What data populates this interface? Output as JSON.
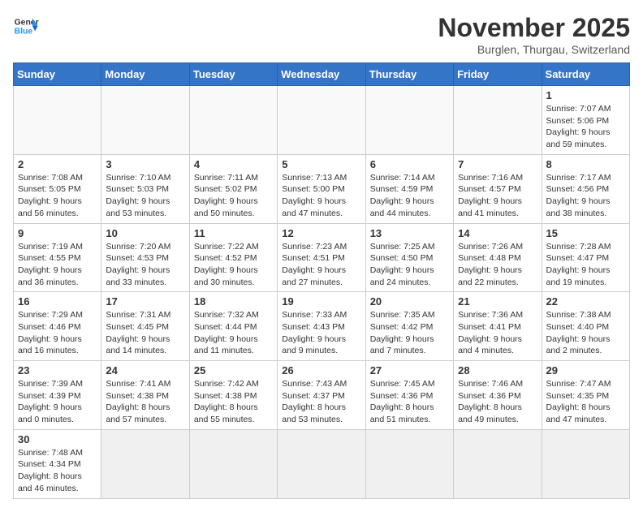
{
  "logo": {
    "text_general": "General",
    "text_blue": "Blue"
  },
  "title": "November 2025",
  "location": "Burglen, Thurgau, Switzerland",
  "weekdays": [
    "Sunday",
    "Monday",
    "Tuesday",
    "Wednesday",
    "Thursday",
    "Friday",
    "Saturday"
  ],
  "weeks": [
    [
      {
        "day": "",
        "info": ""
      },
      {
        "day": "",
        "info": ""
      },
      {
        "day": "",
        "info": ""
      },
      {
        "day": "",
        "info": ""
      },
      {
        "day": "",
        "info": ""
      },
      {
        "day": "",
        "info": ""
      },
      {
        "day": "1",
        "info": "Sunrise: 7:07 AM\nSunset: 5:06 PM\nDaylight: 9 hours and 59 minutes."
      }
    ],
    [
      {
        "day": "2",
        "info": "Sunrise: 7:08 AM\nSunset: 5:05 PM\nDaylight: 9 hours and 56 minutes."
      },
      {
        "day": "3",
        "info": "Sunrise: 7:10 AM\nSunset: 5:03 PM\nDaylight: 9 hours and 53 minutes."
      },
      {
        "day": "4",
        "info": "Sunrise: 7:11 AM\nSunset: 5:02 PM\nDaylight: 9 hours and 50 minutes."
      },
      {
        "day": "5",
        "info": "Sunrise: 7:13 AM\nSunset: 5:00 PM\nDaylight: 9 hours and 47 minutes."
      },
      {
        "day": "6",
        "info": "Sunrise: 7:14 AM\nSunset: 4:59 PM\nDaylight: 9 hours and 44 minutes."
      },
      {
        "day": "7",
        "info": "Sunrise: 7:16 AM\nSunset: 4:57 PM\nDaylight: 9 hours and 41 minutes."
      },
      {
        "day": "8",
        "info": "Sunrise: 7:17 AM\nSunset: 4:56 PM\nDaylight: 9 hours and 38 minutes."
      }
    ],
    [
      {
        "day": "9",
        "info": "Sunrise: 7:19 AM\nSunset: 4:55 PM\nDaylight: 9 hours and 36 minutes."
      },
      {
        "day": "10",
        "info": "Sunrise: 7:20 AM\nSunset: 4:53 PM\nDaylight: 9 hours and 33 minutes."
      },
      {
        "day": "11",
        "info": "Sunrise: 7:22 AM\nSunset: 4:52 PM\nDaylight: 9 hours and 30 minutes."
      },
      {
        "day": "12",
        "info": "Sunrise: 7:23 AM\nSunset: 4:51 PM\nDaylight: 9 hours and 27 minutes."
      },
      {
        "day": "13",
        "info": "Sunrise: 7:25 AM\nSunset: 4:50 PM\nDaylight: 9 hours and 24 minutes."
      },
      {
        "day": "14",
        "info": "Sunrise: 7:26 AM\nSunset: 4:48 PM\nDaylight: 9 hours and 22 minutes."
      },
      {
        "day": "15",
        "info": "Sunrise: 7:28 AM\nSunset: 4:47 PM\nDaylight: 9 hours and 19 minutes."
      }
    ],
    [
      {
        "day": "16",
        "info": "Sunrise: 7:29 AM\nSunset: 4:46 PM\nDaylight: 9 hours and 16 minutes."
      },
      {
        "day": "17",
        "info": "Sunrise: 7:31 AM\nSunset: 4:45 PM\nDaylight: 9 hours and 14 minutes."
      },
      {
        "day": "18",
        "info": "Sunrise: 7:32 AM\nSunset: 4:44 PM\nDaylight: 9 hours and 11 minutes."
      },
      {
        "day": "19",
        "info": "Sunrise: 7:33 AM\nSunset: 4:43 PM\nDaylight: 9 hours and 9 minutes."
      },
      {
        "day": "20",
        "info": "Sunrise: 7:35 AM\nSunset: 4:42 PM\nDaylight: 9 hours and 7 minutes."
      },
      {
        "day": "21",
        "info": "Sunrise: 7:36 AM\nSunset: 4:41 PM\nDaylight: 9 hours and 4 minutes."
      },
      {
        "day": "22",
        "info": "Sunrise: 7:38 AM\nSunset: 4:40 PM\nDaylight: 9 hours and 2 minutes."
      }
    ],
    [
      {
        "day": "23",
        "info": "Sunrise: 7:39 AM\nSunset: 4:39 PM\nDaylight: 9 hours and 0 minutes."
      },
      {
        "day": "24",
        "info": "Sunrise: 7:41 AM\nSunset: 4:38 PM\nDaylight: 8 hours and 57 minutes."
      },
      {
        "day": "25",
        "info": "Sunrise: 7:42 AM\nSunset: 4:38 PM\nDaylight: 8 hours and 55 minutes."
      },
      {
        "day": "26",
        "info": "Sunrise: 7:43 AM\nSunset: 4:37 PM\nDaylight: 8 hours and 53 minutes."
      },
      {
        "day": "27",
        "info": "Sunrise: 7:45 AM\nSunset: 4:36 PM\nDaylight: 8 hours and 51 minutes."
      },
      {
        "day": "28",
        "info": "Sunrise: 7:46 AM\nSunset: 4:36 PM\nDaylight: 8 hours and 49 minutes."
      },
      {
        "day": "29",
        "info": "Sunrise: 7:47 AM\nSunset: 4:35 PM\nDaylight: 8 hours and 47 minutes."
      }
    ],
    [
      {
        "day": "30",
        "info": "Sunrise: 7:48 AM\nSunset: 4:34 PM\nDaylight: 8 hours and 46 minutes."
      },
      {
        "day": "",
        "info": ""
      },
      {
        "day": "",
        "info": ""
      },
      {
        "day": "",
        "info": ""
      },
      {
        "day": "",
        "info": ""
      },
      {
        "day": "",
        "info": ""
      },
      {
        "day": "",
        "info": ""
      }
    ]
  ]
}
